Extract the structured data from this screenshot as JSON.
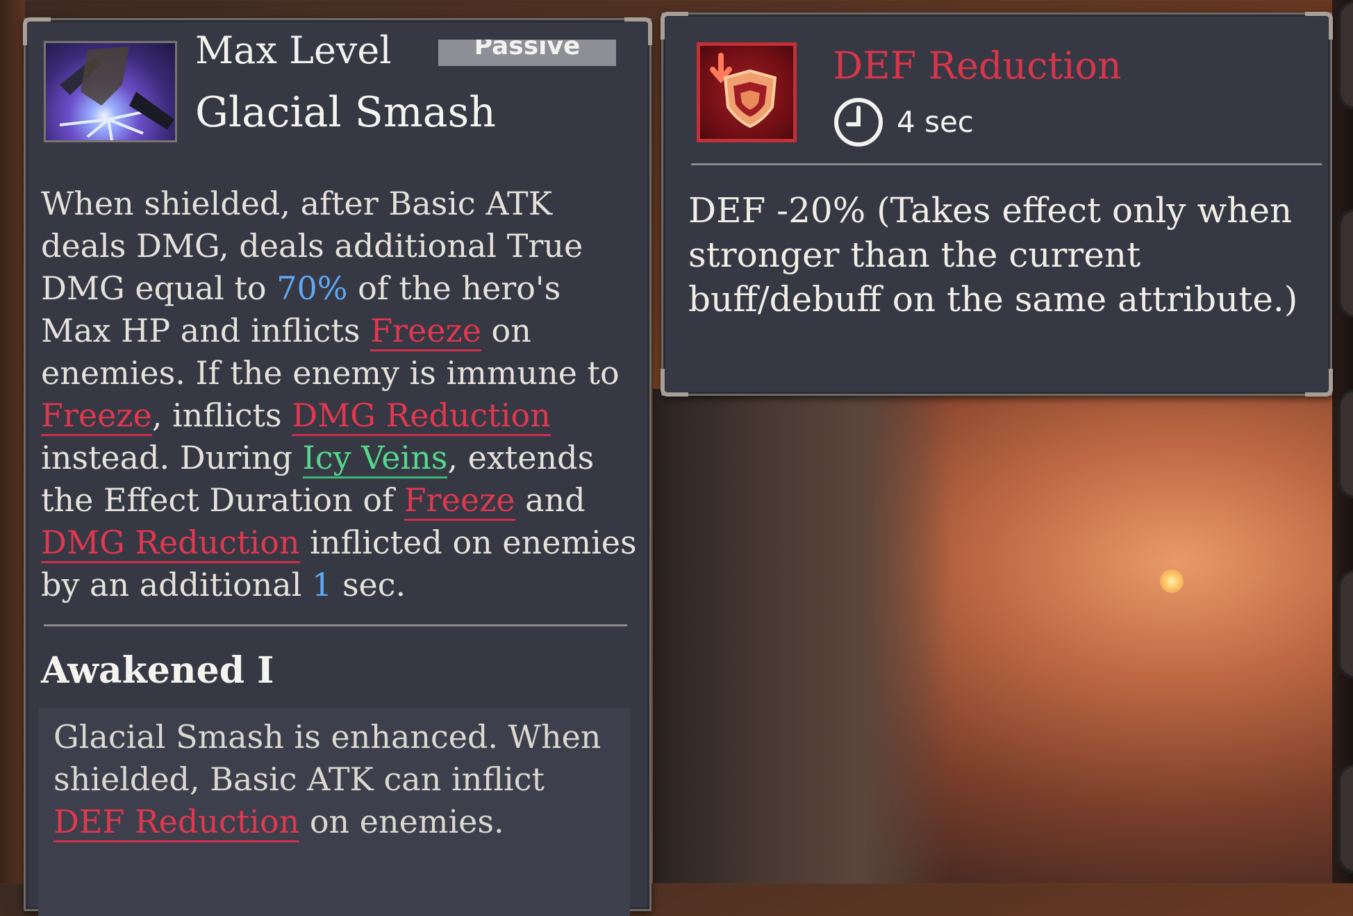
{
  "skill": {
    "level": "Max Level",
    "tag": "Passive",
    "name": "Glacial Smash",
    "desc": {
      "t1": "When shielded, after Basic ATK deals DMG, deals additional True DMG equal to ",
      "pct": "70%",
      "t2": " of the hero's Max HP and inflicts ",
      "kw_freeze": "Freeze",
      "t3": " on enemies. If the enemy is immune to ",
      "t4": ", inflicts ",
      "kw_dmg_reduction": "DMG Reduction",
      "t5": " instead. During ",
      "kw_icy_veins": "Icy Veins",
      "t6": ", extends the Effect Duration of ",
      "t7": " and ",
      "t8": " inflicted on enemies by an additional ",
      "sec_value": "1",
      "t9": " sec."
    },
    "awakened_title": "Awakened I",
    "awakened": {
      "t1": "Glacial Smash is enhanced. When shielded, Basic ATK can inflict ",
      "kw_def_reduction": "DEF Reduction",
      "t2": " on enemies."
    }
  },
  "buff": {
    "name": "DEF Reduction",
    "duration": "4 sec",
    "desc": "DEF -20% (Takes effect only when stronger than the current buff/debuff on the same attribute.)"
  },
  "icons": {
    "skill_icon": "glacial-smash-skill-icon",
    "buff_icon": "def-reduction-shield-icon",
    "timer": "clock-icon"
  },
  "colors": {
    "keyword_red": "#e0384e",
    "keyword_green": "#54d88c",
    "number_blue": "#5fa8f0",
    "panel_bg": "#363844"
  }
}
